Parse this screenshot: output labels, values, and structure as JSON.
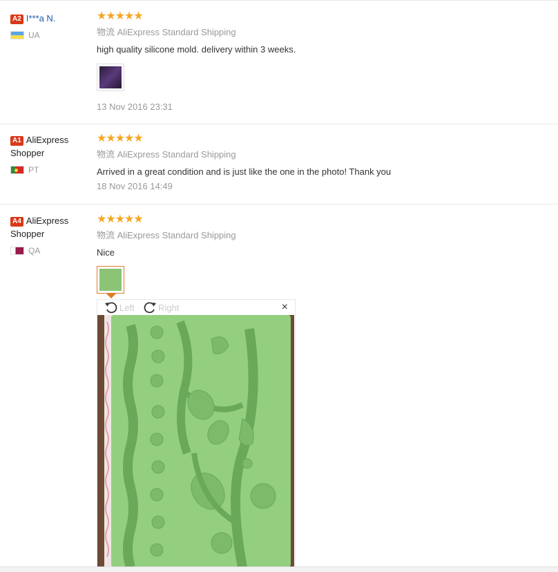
{
  "reviews": [
    {
      "level": "A2",
      "name": "I***a N.",
      "country": "UA",
      "stars": "★★★★★",
      "logistics_label": "物流",
      "logistics": "AliExpress Standard Shipping",
      "text": "high quality silicone mold. delivery within 3 weeks.",
      "date": "13 Nov 2016 23:31"
    },
    {
      "level": "A1",
      "name": "AliExpress Shopper",
      "country": "PT",
      "stars": "★★★★★",
      "logistics_label": "物流",
      "logistics": "AliExpress Standard Shipping",
      "text": "Arrived in a great condition and is just like the one in the photo! Thank you",
      "date": "18 Nov 2016 14:49"
    },
    {
      "level": "A4",
      "name": "AliExpress Shopper",
      "country": "QA",
      "stars": "★★★★★",
      "logistics_label": "物流",
      "logistics": "AliExpress Standard Shipping",
      "text": "Nice"
    }
  ],
  "viewer": {
    "rotate_left": "Left",
    "rotate_right": "Right",
    "close": "×"
  },
  "colors": {
    "star": "#f5a623",
    "level_badge": "#d9391a",
    "active_thumb": "#e07b25",
    "link": "#1a5bb0"
  }
}
